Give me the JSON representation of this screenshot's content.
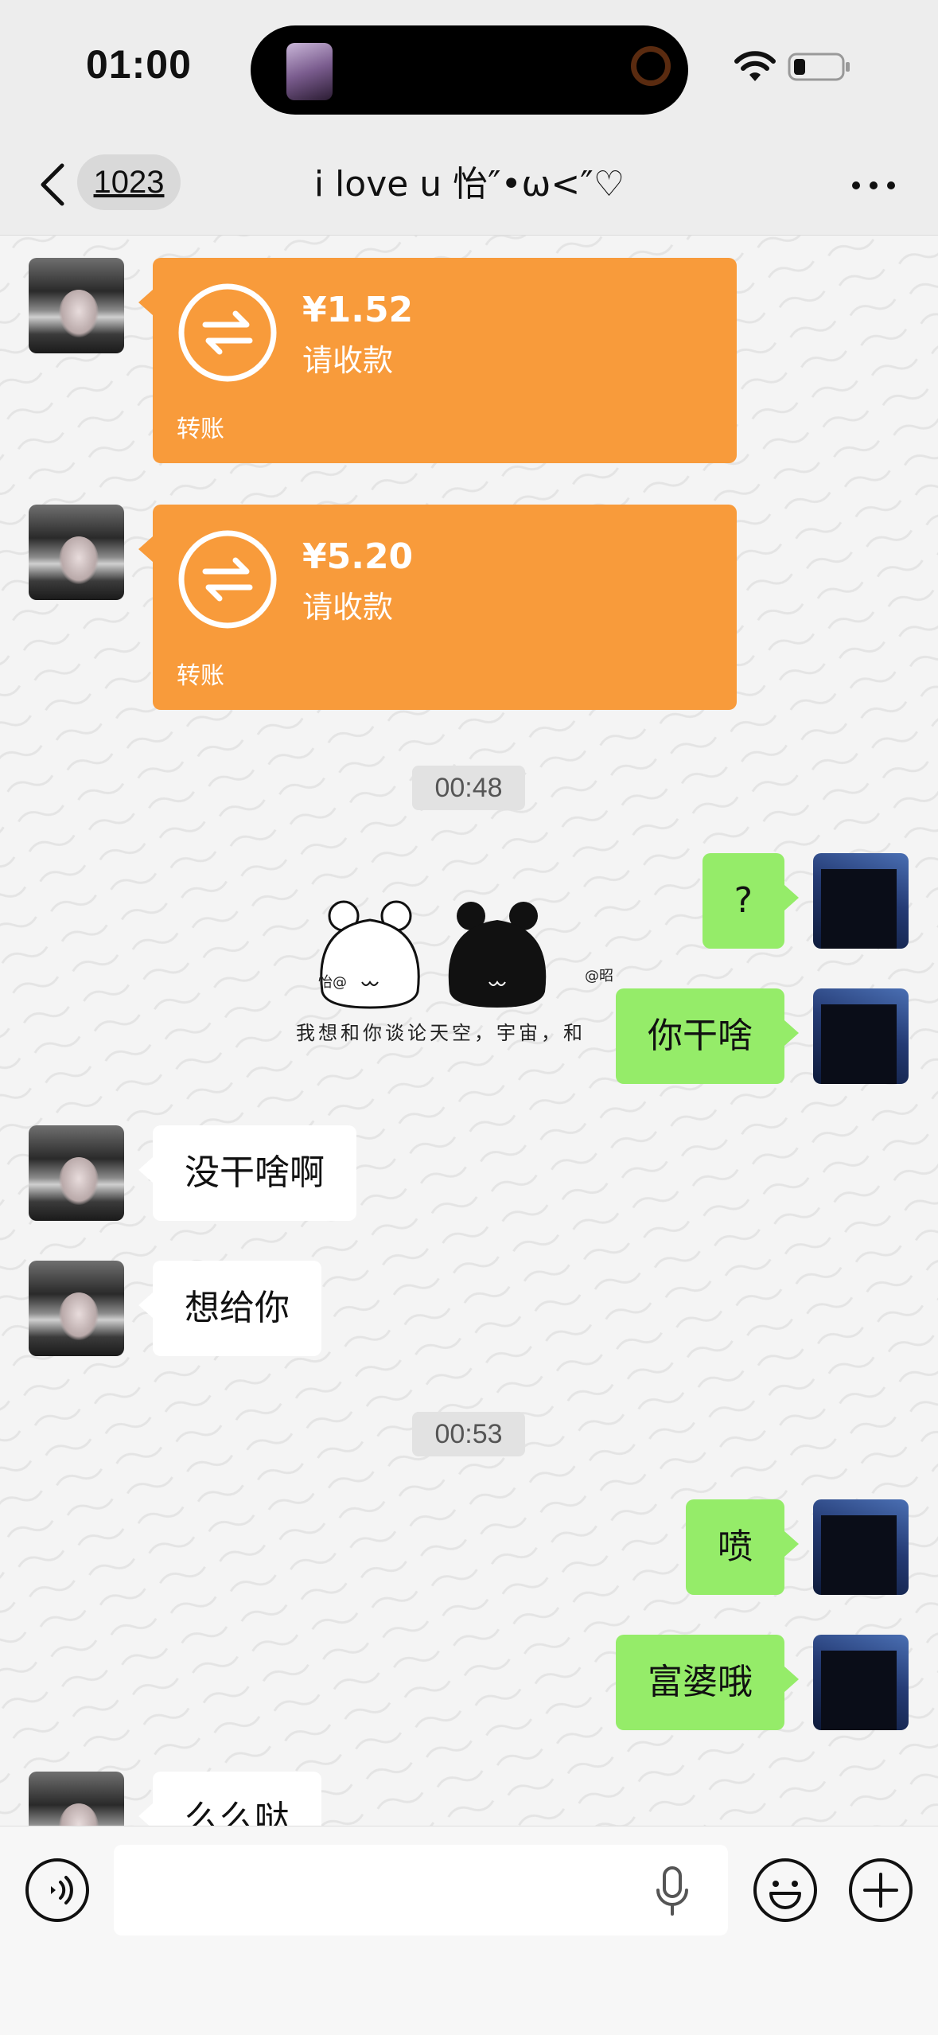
{
  "status_bar": {
    "time": "01:00"
  },
  "nav": {
    "badge": "1023",
    "title": "i love u 怡″•ω<″♡"
  },
  "messages": {
    "transfer1": {
      "amount": "¥1.52",
      "subtitle": "请收款",
      "label": "转账"
    },
    "transfer2": {
      "amount": "¥5.20",
      "subtitle": "请收款",
      "label": "转账"
    },
    "time1": "00:48",
    "me1": "?",
    "me2": "你干啥",
    "sticker": {
      "left_tag": "怡@",
      "right_tag": "@昭",
      "caption": "我想和你谈论天空，宇宙，和"
    },
    "her1": "没干啥啊",
    "her2": "想给你",
    "time2": "00:53",
    "me3": "喷",
    "me4": "富婆哦",
    "her3": "么么哒"
  },
  "input": {
    "placeholder": ""
  },
  "colors": {
    "transfer": "#f89b3b",
    "my_bubble": "#95ec69",
    "background": "#ededed"
  }
}
